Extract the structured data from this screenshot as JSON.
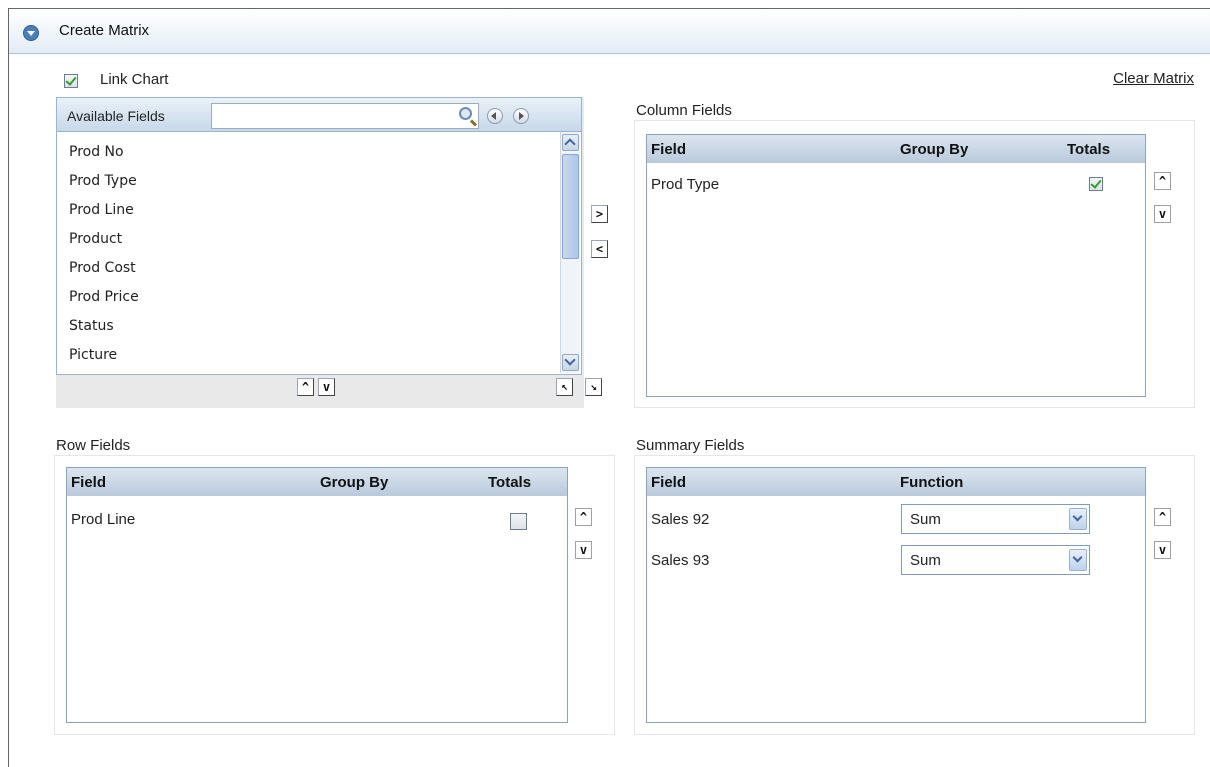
{
  "header": {
    "title": "Create Matrix"
  },
  "link_chart": {
    "label": "Link Chart",
    "checked": true
  },
  "clear_matrix_label": "Clear Matrix",
  "available_fields": {
    "title": "Available Fields",
    "search_value": "",
    "items": [
      "Prod No",
      "Prod Type",
      "Prod Line",
      "Product",
      "Prod Cost",
      "Prod Price",
      "Status",
      "Picture"
    ]
  },
  "transfer_buttons": {
    "add": ">",
    "remove": "<"
  },
  "move_buttons": {
    "up": "^",
    "down": "v"
  },
  "column_fields": {
    "title": "Column Fields",
    "headers": {
      "field": "Field",
      "group_by": "Group By",
      "totals": "Totals"
    },
    "rows": [
      {
        "field": "Prod Type",
        "group_by": "",
        "totals": true
      }
    ]
  },
  "row_fields": {
    "title": "Row Fields",
    "headers": {
      "field": "Field",
      "group_by": "Group By",
      "totals": "Totals"
    },
    "rows": [
      {
        "field": "Prod Line",
        "group_by": "",
        "totals": false
      }
    ]
  },
  "summary_fields": {
    "title": "Summary Fields",
    "headers": {
      "field": "Field",
      "function": "Function"
    },
    "rows": [
      {
        "field": "Sales 92",
        "function": "Sum"
      },
      {
        "field": "Sales 93",
        "function": "Sum"
      }
    ]
  }
}
